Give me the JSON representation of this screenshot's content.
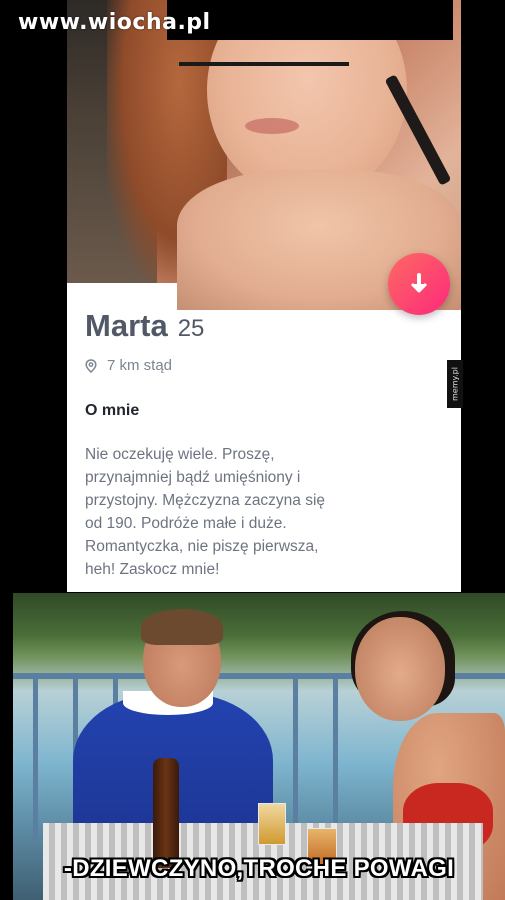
{
  "watermark": "www.wiocha.pl",
  "side_badge": "memy.pl",
  "profile": {
    "name": "Marta",
    "age": "25",
    "distance": "7 km stąd",
    "about_title": "O mnie",
    "bio_lines": [
      "Nie oczekuję wiele. Proszę,",
      "przynajmniej bądź umięśniony i",
      "przystojny. Mężczyzna zaczyna się",
      "od 190. Podróże małe i duże.",
      "Romantyczka, nie piszę pierwsza,",
      "heh! Zaskocz mnie!"
    ],
    "fab_icon": "arrow-down-icon"
  },
  "meme": {
    "caption": "-DZIEWCZYNO,TROCHE POWAGI"
  },
  "colors": {
    "fab_gradient_start": "#fd6a63",
    "fab_gradient_end": "#fd297b",
    "name_text": "#505965",
    "muted_text": "#7c8591"
  }
}
